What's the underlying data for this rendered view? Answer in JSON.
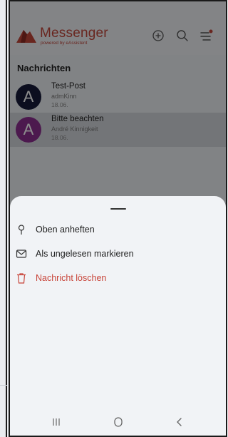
{
  "app": {
    "brand_title": "Messenger",
    "brand_subtitle": "powered by eAssistent",
    "icons": [
      "logo-icon",
      "add-circle-icon",
      "search-icon",
      "menu-icon"
    ],
    "notification_dot_color": "#c0453a"
  },
  "list": {
    "section_title": "Nachrichten",
    "conversations": [
      {
        "avatar": "A",
        "avatar_color": "#161a3a",
        "title": "Test-Post",
        "sender": "admKinn",
        "date": "18.06."
      },
      {
        "avatar": "A",
        "avatar_color": "#8a2e8f",
        "title": "Bitte beachten",
        "sender": "André Kinnigkeit",
        "date": "18.06."
      }
    ]
  },
  "sheet": {
    "actions": [
      {
        "icon": "pin-icon",
        "label": "Oben anheften"
      },
      {
        "icon": "envelope-icon",
        "label": "Als ungelesen markieren"
      },
      {
        "icon": "trash-icon",
        "label": "Nachricht löschen",
        "color": "#c8453a"
      }
    ]
  },
  "system_nav": {
    "icons": [
      "recents-icon",
      "home-icon",
      "back-icon"
    ]
  }
}
